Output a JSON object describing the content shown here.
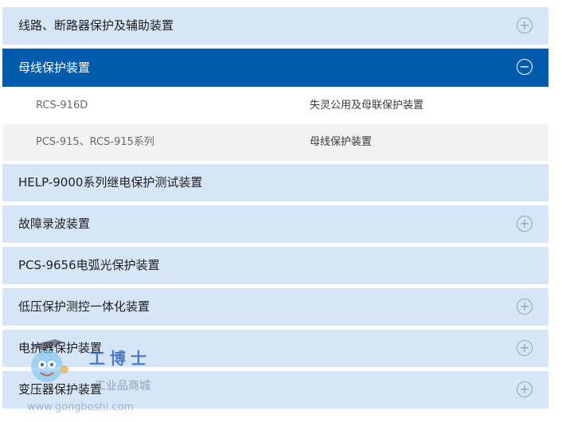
{
  "accordion": [
    {
      "label": "线路、断路器保护及辅助装置",
      "toggle": "+",
      "expanded": false
    },
    {
      "label": "母线保护装置",
      "toggle": "−",
      "expanded": true,
      "items": [
        {
          "model": "RCS-916D",
          "desc": "失灵公用及母联保护装置"
        },
        {
          "model": "PCS-915、RCS-915系列",
          "desc": "母线保护装置"
        }
      ]
    },
    {
      "label": "HELP-9000系列继电保护测试装置",
      "toggle": "",
      "expanded": false
    },
    {
      "label": "故障录波装置",
      "toggle": "+",
      "expanded": false
    },
    {
      "label": "PCS-9656电弧光保护装置",
      "toggle": "",
      "expanded": false
    },
    {
      "label": "低压保护测控一体化装置",
      "toggle": "+",
      "expanded": false
    },
    {
      "label": "电抗器保护装置",
      "toggle": "+",
      "expanded": false
    },
    {
      "label": "变压器保护装置",
      "toggle": "+",
      "expanded": false
    }
  ],
  "watermark": {
    "brand": "工博士",
    "subtitle": "工业品商城",
    "url": "www.gongboshi.com"
  },
  "colors": {
    "row_bg": "#d6e6f7",
    "active_bg": "#005bac",
    "alt_bg": "#f2f2f2"
  }
}
